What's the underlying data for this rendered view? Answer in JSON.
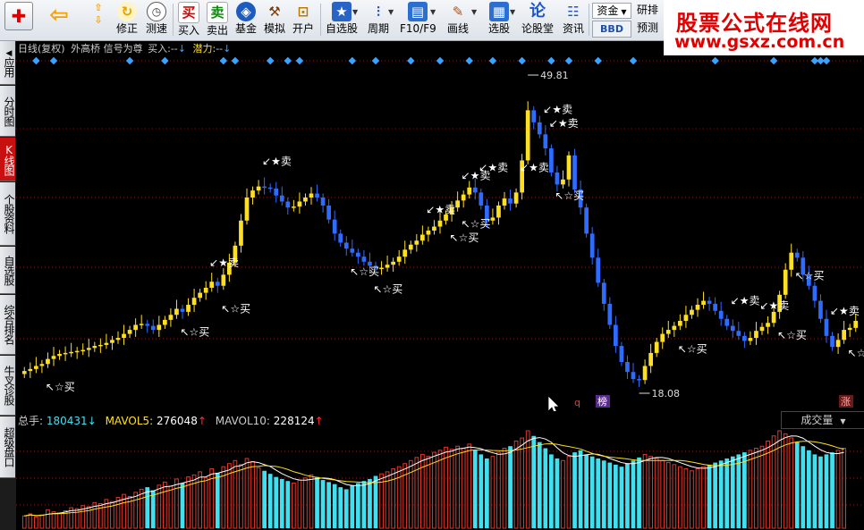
{
  "toolbar": {
    "tools": [
      {
        "label": "修正",
        "icon": "check-icon"
      },
      {
        "label": "测速",
        "icon": "clock-icon"
      },
      {
        "label": "买入",
        "icon": "buy-icon",
        "glyph": "买"
      },
      {
        "label": "卖出",
        "icon": "sell-icon",
        "glyph": "卖"
      },
      {
        "label": "基金",
        "icon": "fund-icon"
      },
      {
        "label": "模拟",
        "icon": "hammer-icon"
      },
      {
        "label": "开户",
        "icon": "lock-icon"
      },
      {
        "label": "自选股",
        "icon": "star-icon"
      },
      {
        "label": "周期",
        "icon": "period-icon"
      },
      {
        "label": "F10/F9",
        "icon": "f10-icon"
      },
      {
        "label": "画线",
        "icon": "pen-icon"
      },
      {
        "label": "选股",
        "icon": "screen-icon"
      },
      {
        "label": "论股堂",
        "icon": "forum-icon",
        "glyph": "论"
      },
      {
        "label": "资讯",
        "icon": "info-icon"
      }
    ],
    "fund_label": "资金",
    "bbd_label": "BBD",
    "research_label": "研排",
    "forecast_label": "预测"
  },
  "watermark": {
    "title": "股票公式在线网",
    "url": "www.gsxz.com.cn"
  },
  "sidebar": {
    "tabs": [
      "应用",
      "分时图",
      "K线图",
      "个股资料",
      "自选股",
      "综合排名",
      "牛叉诊股",
      "超级盘口"
    ]
  },
  "chart": {
    "title": "日线(复权)",
    "indicator": "外高桥 信号为尊",
    "buy_label": "买入:",
    "buy_value": "--",
    "potential_label": "潜力:",
    "potential_value": "--",
    "high_label": "49.81",
    "low_label": "18.08",
    "buy_signal": "☆买",
    "sell_signal": "★卖",
    "badge_q": "q",
    "badge_bang": "榜",
    "badge_zhang": "涨"
  },
  "volume": {
    "total_label": "总手:",
    "total_value": "180431",
    "mavol5_label": "MAVOL5:",
    "mavol5_value": "276048",
    "mavol10_label": "MAVOL10:",
    "mavol10_value": "228124",
    "dropdown_label": "成交量"
  },
  "colors": {
    "up": "#ffe020",
    "down": "#2e6bff",
    "vol_up": "#e0392c",
    "vol_down": "#40e0f0",
    "signal": "#ffffff",
    "marker": "#3aa3ff",
    "grid": "#8a1515"
  },
  "chart_data": {
    "type": "candlestick",
    "ylim": [
      18.08,
      49.81
    ],
    "closes": [
      20.3,
      20.5,
      20.8,
      21.0,
      21.5,
      21.8,
      22.0,
      22.1,
      22.2,
      22.3,
      22.4,
      22.6,
      22.8,
      22.9,
      23.1,
      23.4,
      23.6,
      24.0,
      24.4,
      24.9,
      25.0,
      24.8,
      24.4,
      24.9,
      25.4,
      25.9,
      26.5,
      26.2,
      26.9,
      27.6,
      28.1,
      28.6,
      29.2,
      28.8,
      29.9,
      31.1,
      32.8,
      35.3,
      37.6,
      38.3,
      38.7,
      38.6,
      38.5,
      37.8,
      37.2,
      36.6,
      36.7,
      37.2,
      37.6,
      38.0,
      37.6,
      36.8,
      35.4,
      34.0,
      33.1,
      32.5,
      32.1,
      31.7,
      31.2,
      30.8,
      30.6,
      30.6,
      30.9,
      31.2,
      31.7,
      32.4,
      32.9,
      33.3,
      33.9,
      34.3,
      34.7,
      35.3,
      35.9,
      36.6,
      37.3,
      37.9,
      38.6,
      38.1,
      36.8,
      35.3,
      35.6,
      36.8,
      37.5,
      37.0,
      38.1,
      41.3,
      46.3,
      45.1,
      43.9,
      42.5,
      40.1,
      38.9,
      39.4,
      41.8,
      38.4,
      36.6,
      34.0,
      31.6,
      29.1,
      27.0,
      24.9,
      22.8,
      21.2,
      20.2,
      19.5,
      19.4,
      20.8,
      22.1,
      23.2,
      24.0,
      24.4,
      24.8,
      25.3,
      25.9,
      26.4,
      26.9,
      27.3,
      27.0,
      26.3,
      25.5,
      24.8,
      24.3,
      23.8,
      23.3,
      23.6,
      24.3,
      24.7,
      25.1,
      26.2,
      27.9,
      30.4,
      32.1,
      31.6,
      29.9,
      28.8,
      27.3,
      25.5,
      23.8,
      22.7,
      23.4,
      24.4,
      24.6,
      25.3
    ],
    "volume": [
      12,
      14,
      11,
      13,
      18,
      16,
      15,
      17,
      20,
      19,
      22,
      21,
      25,
      24,
      28,
      26,
      30,
      33,
      31,
      35,
      38,
      40,
      37,
      42,
      45,
      41,
      48,
      44,
      50,
      52,
      55,
      49,
      58,
      54,
      60,
      63,
      66,
      62,
      68,
      65,
      59,
      56,
      53,
      50,
      48,
      46,
      44,
      47,
      49,
      52,
      50,
      47,
      45,
      43,
      40,
      38,
      42,
      44,
      46,
      48,
      51,
      53,
      55,
      58,
      60,
      63,
      66,
      69,
      72,
      70,
      74,
      76,
      79,
      77,
      80,
      78,
      82,
      76,
      72,
      68,
      70,
      74,
      78,
      80,
      85,
      88,
      95,
      90,
      84,
      78,
      72,
      68,
      66,
      70,
      74,
      76,
      72,
      70,
      68,
      66,
      64,
      62,
      60,
      63,
      66,
      69,
      72,
      70,
      68,
      66,
      64,
      62,
      60,
      58,
      56,
      58,
      60,
      62,
      64,
      66,
      68,
      70,
      72,
      74,
      76,
      78,
      80,
      85,
      90,
      95,
      92,
      88,
      84,
      80,
      76,
      72,
      70,
      72,
      74,
      76,
      78
    ]
  }
}
